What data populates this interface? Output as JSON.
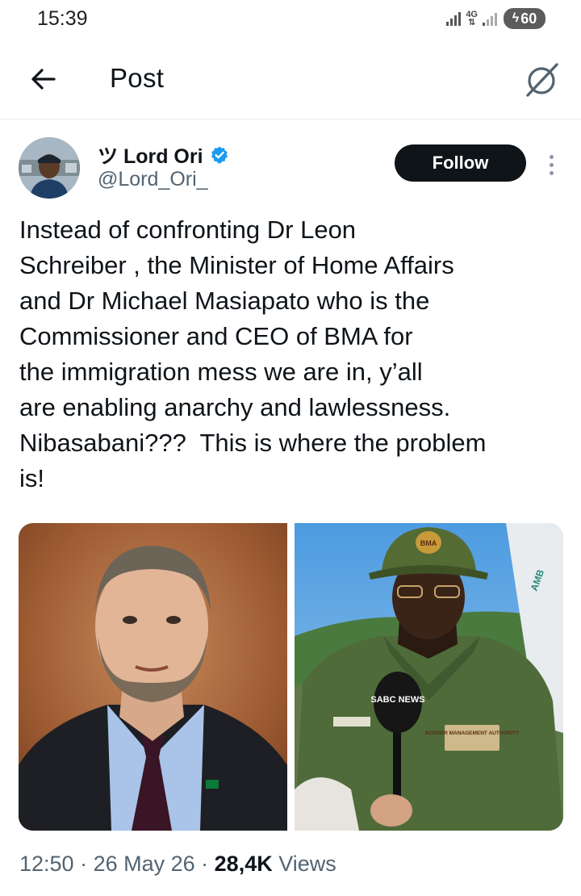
{
  "status_bar": {
    "time": "15:39",
    "network": "4G",
    "battery": "60"
  },
  "header": {
    "title": "Post",
    "back_icon": "arrow-left-icon",
    "grok_icon": "grok-icon"
  },
  "author": {
    "name": "ツ Lord Ori",
    "handle": "@Lord_Ori_",
    "verified": true
  },
  "follow_label": "Follow",
  "tweet_lines": [
    "Instead of confronting Dr Leon",
    "Schreiber , the Minister of Home Affairs",
    "and Dr Michael Masiapato who is the",
    "Commissioner and CEO of BMA for",
    "the immigration mess we are in, y’all",
    "are enabling anarchy and lawlessness.",
    "Nibasabani???  This is where the problem",
    "is!"
  ],
  "media": {
    "right_image_texts": {
      "microphone_logo": "SABC NEWS",
      "cap_badge": "BMA",
      "shoulder_patch": "BORDER MANAGEMENT AUTHORITY",
      "banner": "AMB"
    }
  },
  "meta": {
    "time": "12:50",
    "separator": " · ",
    "date": "26 May 26",
    "views_count": "28,4K",
    "views_label": " Views"
  },
  "colors": {
    "follow_bg": "#0f1419",
    "verified": "#1d9bf0",
    "secondary_text": "#536471"
  }
}
